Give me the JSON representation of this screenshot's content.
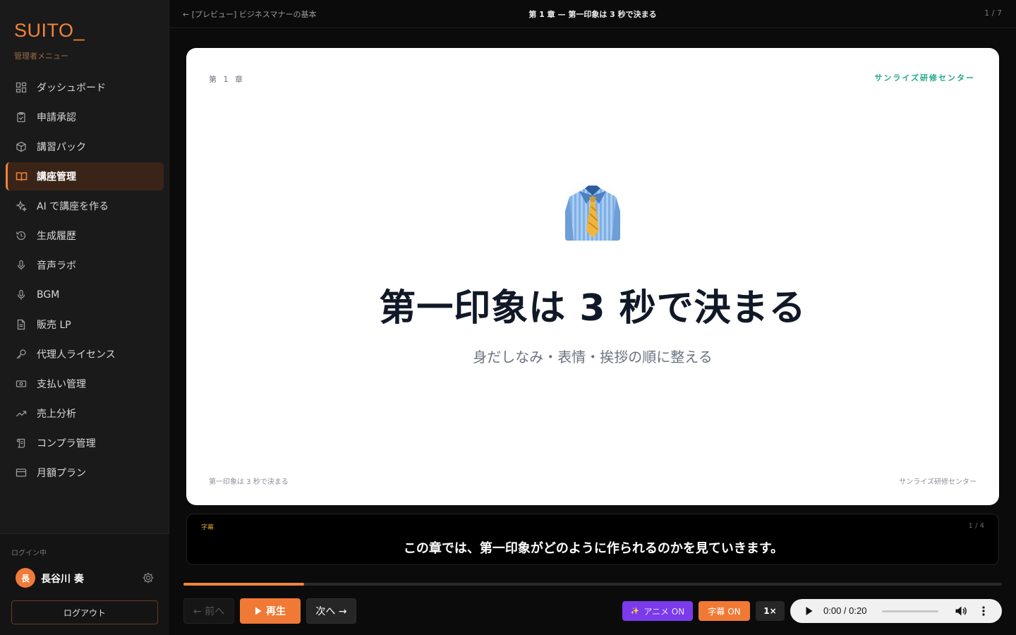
{
  "sidebar": {
    "brand": "SUITO_",
    "subtitle": "管理者メニュー",
    "items": [
      {
        "label": "ダッシュボード",
        "icon": "dashboard-icon"
      },
      {
        "label": "申請承認",
        "icon": "clipboard-check-icon"
      },
      {
        "label": "講習パック",
        "icon": "package-icon"
      },
      {
        "label": "講座管理",
        "icon": "book-open-icon",
        "active": true
      },
      {
        "label": "AI で講座を作る",
        "icon": "sparkles-icon"
      },
      {
        "label": "生成履歴",
        "icon": "history-icon"
      },
      {
        "label": "音声ラボ",
        "icon": "microphone-icon"
      },
      {
        "label": "BGM",
        "icon": "microphone-icon"
      },
      {
        "label": "販売 LP",
        "icon": "document-icon"
      },
      {
        "label": "代理人ライセンス",
        "icon": "key-icon"
      },
      {
        "label": "支払い管理",
        "icon": "banknote-icon"
      },
      {
        "label": "売上分析",
        "icon": "trending-up-icon"
      },
      {
        "label": "コンプラ管理",
        "icon": "scroll-icon"
      },
      {
        "label": "月額プラン",
        "icon": "credit-card-icon"
      }
    ],
    "login_label": "ログイン中",
    "user_initial": "長",
    "user_name": "長谷川 奏",
    "logout": "ログアウト"
  },
  "topbar": {
    "back": "← [プレビュー] ビジネスマナーの基本",
    "title": "第 1 章 — 第一印象は 3 秒で決まる",
    "page": "1 / 7"
  },
  "slide": {
    "chapter": "第 1 章",
    "brand": "サンライズ研修センター",
    "emoji": "shirt-and-tie-emoji",
    "title": "第一印象は 3 秒で決まる",
    "subtitle": "身だしなみ・表情・挨拶の順に整える",
    "footer_left": "第一印象は 3 秒で決まる",
    "footer_right": "サンライズ研修センター"
  },
  "caption": {
    "label": "字幕",
    "count": "1 / 4",
    "text": "この章では、第一印象がどのように作られるのかを見ていきます。"
  },
  "progress": 0.147,
  "controls": {
    "prev": "← 前へ",
    "play": "再生",
    "next": "次へ →",
    "anim": "アニメ ON",
    "subtitles": "字幕 ON",
    "speed": "1×",
    "audio_time": "0:00 / 0:20"
  },
  "colors": {
    "accent": "#f07a35",
    "purple": "#7c3aed",
    "teal": "#22a88a"
  }
}
